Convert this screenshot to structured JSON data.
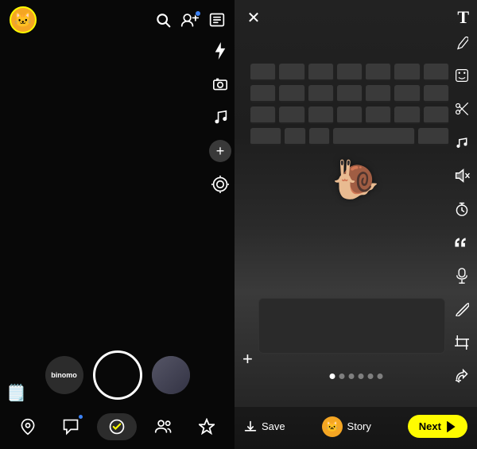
{
  "left_panel": {
    "avatar_emoji": "🐱",
    "search_icon": "search",
    "add_friend_icon": "add-friend",
    "has_notification": true,
    "side_icons": {
      "flash": "⚡",
      "video": "📹",
      "music": "♪",
      "plus": "+",
      "lens": "◎"
    },
    "filter_label": "binomo",
    "bottom_nav": {
      "map_icon": "map",
      "chat_icon": "chat",
      "activity_icon": "activity",
      "friends_icon": "friends",
      "spotlight_icon": "spotlight"
    },
    "memories_icon": "🗒"
  },
  "right_panel": {
    "close_label": "×",
    "tools": [
      "pencil",
      "sticker",
      "scissors",
      "music",
      "mute",
      "timer",
      "quote",
      "mic",
      "paperclip",
      "crop",
      "redo"
    ],
    "snail_emoji": "🐌",
    "plus_label": "+",
    "dots_count": 6,
    "active_dot": 1,
    "save_label": "Save",
    "story_label": "Story",
    "next_label": "Next",
    "text_tool_label": "T"
  }
}
